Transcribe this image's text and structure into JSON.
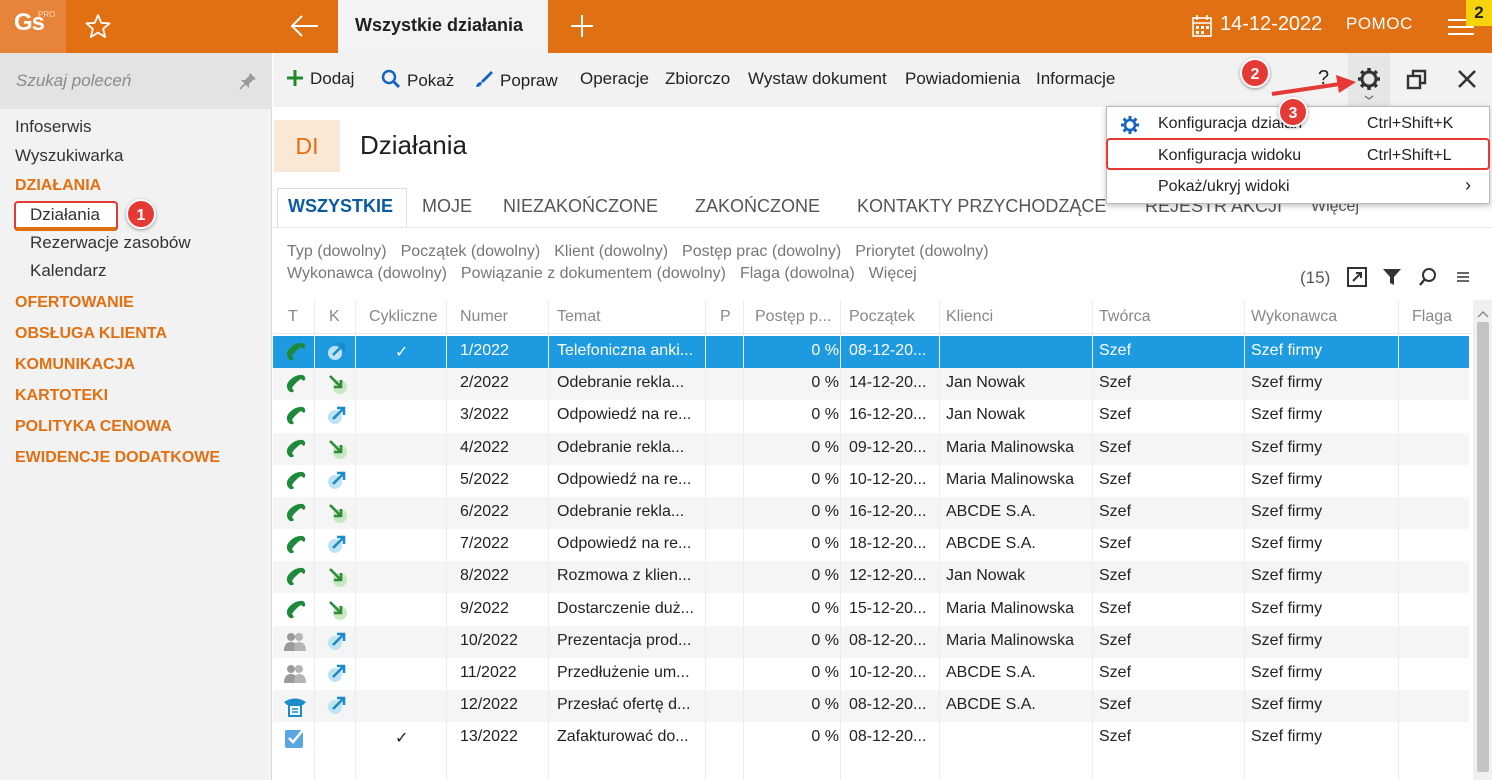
{
  "app": {
    "logo_text": "Gs",
    "logo_badge": "PRO",
    "active_tab": "Wszystkie działania",
    "date": "14-12-2022",
    "help_label": "POMOC",
    "notification_count": "2"
  },
  "sidebar": {
    "search_placeholder": "Szukaj poleceń",
    "items": [
      {
        "label": "Infoserwis"
      },
      {
        "label": "Wyszukiwarka"
      }
    ],
    "sections": [
      {
        "label": "DZIAŁANIA",
        "children": [
          "Działania",
          "Rezerwacje zasobów",
          "Kalendarz"
        ]
      },
      {
        "label": "OFERTOWANIE"
      },
      {
        "label": "OBSŁUGA KLIENTA"
      },
      {
        "label": "KOMUNIKACJA"
      },
      {
        "label": "KARTOTEKI"
      },
      {
        "label": "POLITYKA CENOWA"
      },
      {
        "label": "EWIDENCJE DODATKOWE"
      }
    ]
  },
  "callouts": [
    "1",
    "2",
    "3"
  ],
  "toolbar": {
    "add": "Dodaj",
    "show": "Pokaż",
    "edit": "Popraw",
    "operations": "Operacje",
    "bulk": "Zbiorczo",
    "issue_doc": "Wystaw dokument",
    "notifications": "Powiadomienia",
    "info": "Informacje",
    "help": "?"
  },
  "header": {
    "badge": "DI",
    "title": "Działania"
  },
  "tabs": [
    "WSZYSTKIE",
    "MOJE",
    "NIEZAKOŃCZONE",
    "ZAKOŃCZONE",
    "KONTAKTY PRZYCHODZĄCE",
    "REJESTR AKCJI",
    "Więcej"
  ],
  "filters": {
    "row1": [
      "Typ (dowolny)",
      "Początek (dowolny)",
      "Klient (dowolny)",
      "Postęp prac (dowolny)",
      "Priorytet (dowolny)"
    ],
    "row2": [
      "Wykonawca (dowolny)",
      "Powiązanie z dokumentem (dowolny)",
      "Flaga (dowolna)",
      "Więcej"
    ]
  },
  "record_count": "(15)",
  "columns": [
    "T",
    "K",
    "Cykliczne",
    "Numer",
    "Temat",
    "P",
    "Postęp p...",
    "Początek",
    "Klienci",
    "Twórca",
    "Wykonawca",
    "Flaga"
  ],
  "rows": [
    {
      "type": "phone",
      "dir": "out",
      "cyclic": "✓",
      "number": "1/2022",
      "subject": "Telefoniczna anki...",
      "progress": "0 %",
      "start": "08-12-20...",
      "client": "",
      "creator": "Szef",
      "assignee": "Szef firmy"
    },
    {
      "type": "phone",
      "dir": "in",
      "cyclic": "",
      "number": "2/2022",
      "subject": "Odebranie rekla...",
      "progress": "0 %",
      "start": "14-12-20...",
      "client": "Jan Nowak",
      "creator": "Szef",
      "assignee": "Szef firmy"
    },
    {
      "type": "phone",
      "dir": "out",
      "cyclic": "",
      "number": "3/2022",
      "subject": "Odpowiedź na re...",
      "progress": "0 %",
      "start": "16-12-20...",
      "client": "Jan Nowak",
      "creator": "Szef",
      "assignee": "Szef firmy"
    },
    {
      "type": "phone",
      "dir": "in",
      "cyclic": "",
      "number": "4/2022",
      "subject": "Odebranie rekla...",
      "progress": "0 %",
      "start": "09-12-20...",
      "client": "Maria Malinowska",
      "creator": "Szef",
      "assignee": "Szef firmy"
    },
    {
      "type": "phone",
      "dir": "out",
      "cyclic": "",
      "number": "5/2022",
      "subject": "Odpowiedź na re...",
      "progress": "0 %",
      "start": "10-12-20...",
      "client": "Maria Malinowska",
      "creator": "Szef",
      "assignee": "Szef firmy"
    },
    {
      "type": "phone",
      "dir": "in",
      "cyclic": "",
      "number": "6/2022",
      "subject": "Odebranie rekla...",
      "progress": "0 %",
      "start": "16-12-20...",
      "client": "ABCDE S.A.",
      "creator": "Szef",
      "assignee": "Szef firmy"
    },
    {
      "type": "phone",
      "dir": "out",
      "cyclic": "",
      "number": "7/2022",
      "subject": "Odpowiedź na re...",
      "progress": "0 %",
      "start": "18-12-20...",
      "client": "ABCDE S.A.",
      "creator": "Szef",
      "assignee": "Szef firmy"
    },
    {
      "type": "phone",
      "dir": "in",
      "cyclic": "",
      "number": "8/2022",
      "subject": "Rozmowa z klien...",
      "progress": "0 %",
      "start": "12-12-20...",
      "client": "Jan Nowak",
      "creator": "Szef",
      "assignee": "Szef firmy"
    },
    {
      "type": "phone",
      "dir": "in",
      "cyclic": "",
      "number": "9/2022",
      "subject": "Dostarczenie duż...",
      "progress": "0 %",
      "start": "15-12-20...",
      "client": "Maria Malinowska",
      "creator": "Szef",
      "assignee": "Szef firmy"
    },
    {
      "type": "meeting",
      "dir": "out",
      "cyclic": "",
      "number": "10/2022",
      "subject": "Prezentacja prod...",
      "progress": "0 %",
      "start": "08-12-20...",
      "client": "Maria Malinowska",
      "creator": "Szef",
      "assignee": "Szef firmy"
    },
    {
      "type": "meeting",
      "dir": "out",
      "cyclic": "",
      "number": "11/2022",
      "subject": "Przedłużenie um...",
      "progress": "0 %",
      "start": "10-12-20...",
      "client": "ABCDE S.A.",
      "creator": "Szef",
      "assignee": "Szef firmy"
    },
    {
      "type": "fax",
      "dir": "out",
      "cyclic": "",
      "number": "12/2022",
      "subject": "Przesłać ofertę d...",
      "progress": "0 %",
      "start": "08-12-20...",
      "client": "ABCDE S.A.",
      "creator": "Szef",
      "assignee": "Szef firmy"
    },
    {
      "type": "task",
      "dir": "",
      "cyclic": "✓",
      "number": "13/2022",
      "subject": "Zafakturować do...",
      "progress": "0 %",
      "start": "08-12-20...",
      "client": "",
      "creator": "Szef",
      "assignee": "Szef firmy"
    }
  ],
  "dropdown": [
    {
      "label": "Konfiguracja działań",
      "shortcut": "Ctrl+Shift+K",
      "icon": "gear-icon"
    },
    {
      "label": "Konfiguracja widoku",
      "shortcut": "Ctrl+Shift+L"
    },
    {
      "label": "Pokaż/ukryj widoki",
      "shortcut": "›"
    }
  ],
  "colors": {
    "brand": "#e07012",
    "selection": "#1e9be0",
    "callout": "#e53935",
    "link": "#0a5aa0"
  }
}
